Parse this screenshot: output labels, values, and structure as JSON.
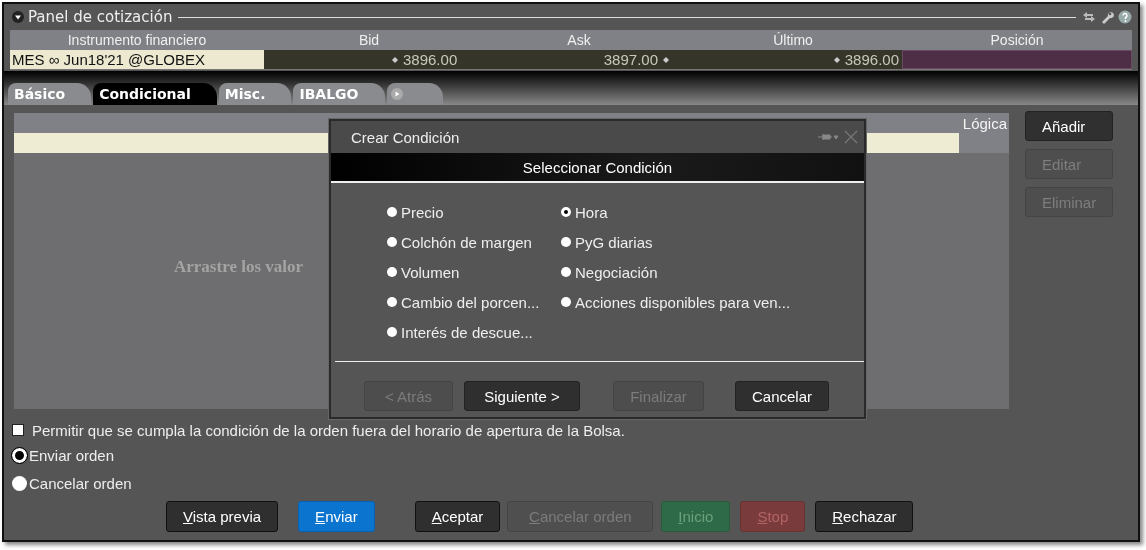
{
  "panel": {
    "title": "Panel de cotización"
  },
  "quote_table": {
    "columns": [
      "Instrumento financiero",
      "Bid",
      "Ask",
      "Último",
      "Posición"
    ],
    "row": {
      "instrument": "MES ∞ Jun18'21 @GLOBEX",
      "bid": "3896.00",
      "ask": "3897.00",
      "last": "3896.00"
    }
  },
  "tabs": [
    {
      "label": "Básico",
      "selected": false
    },
    {
      "label": "Condicional",
      "selected": true
    },
    {
      "label": "Misc.",
      "selected": false
    },
    {
      "label": "IBALGO",
      "selected": false
    }
  ],
  "conditions": {
    "column": "Lógica",
    "empty_hint": "Arrastre los valor"
  },
  "side_buttons": [
    {
      "label": "Añadir",
      "disabled": false
    },
    {
      "label": "Editar",
      "disabled": true
    },
    {
      "label": "Eliminar",
      "disabled": true
    }
  ],
  "dialog": {
    "title": "Crear Condición",
    "heading": "Seleccionar Condición",
    "option_columns": [
      [
        {
          "label": "Precio",
          "selected": false
        },
        {
          "label": "Colchón de margen",
          "selected": false
        },
        {
          "label": "Volumen",
          "selected": false
        },
        {
          "label": "Cambio del porcen...",
          "selected": false
        },
        {
          "label": "Interés de descue...",
          "selected": false
        }
      ],
      [
        {
          "label": "Hora",
          "selected": true
        },
        {
          "label": "PyG diarias",
          "selected": false
        },
        {
          "label": "Negociación",
          "selected": false
        },
        {
          "label": "Acciones disponibles para ven...",
          "selected": false
        }
      ]
    ],
    "buttons": [
      {
        "label": "< Atrás",
        "disabled": true
      },
      {
        "label": "Siguiente >",
        "disabled": false
      },
      {
        "label": "Finalizar",
        "disabled": true
      },
      {
        "label": "Cancelar",
        "disabled": false
      }
    ]
  },
  "outside_hours": {
    "label": "Permitir que se cumpla la condición de la orden fuera del horario de apertura de la Bolsa.",
    "checked": false
  },
  "order_actions": [
    {
      "label": "Enviar orden",
      "selected": true
    },
    {
      "label": "Cancelar orden",
      "selected": false
    }
  ],
  "footer_buttons": [
    {
      "label": "Vista previa",
      "kind": "neutral",
      "disabled": false
    },
    {
      "label": "Enviar",
      "kind": "primary",
      "disabled": false
    },
    {
      "label": "Aceptar",
      "kind": "neutral",
      "disabled": false
    },
    {
      "label": "Cancelar orden",
      "kind": "neutral",
      "disabled": true
    },
    {
      "label": "Inicio",
      "kind": "start",
      "disabled": true
    },
    {
      "label": "Stop",
      "kind": "stop",
      "disabled": true
    },
    {
      "label": "Rechazar",
      "kind": "neutral",
      "disabled": false
    }
  ]
}
